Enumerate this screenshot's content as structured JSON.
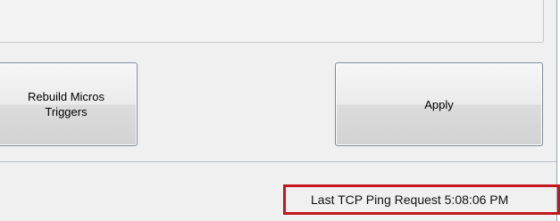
{
  "buttons": {
    "rebuild_label": "Rebuild Micros\nTriggers",
    "apply_label": "Apply"
  },
  "status": {
    "ping_text": "Last TCP Ping Request 5:08:06 PM"
  },
  "colors": {
    "highlight_border": "#c4161c",
    "window_bg": "#f0f0f0"
  }
}
